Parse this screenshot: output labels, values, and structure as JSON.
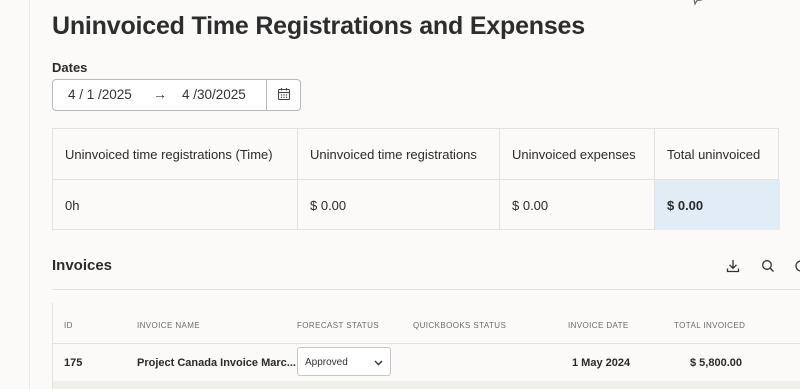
{
  "page": {
    "title": "Uninvoiced Time Registrations and Expenses"
  },
  "dates": {
    "label": "Dates",
    "start": "4 / 1 /2025",
    "arrow": "→",
    "end": "4 /30/2025"
  },
  "summary": {
    "headers": [
      "Uninvoiced time registrations (Time)",
      "Uninvoiced time registrations",
      "Uninvoiced expenses",
      "Total uninvoiced"
    ],
    "values": [
      "0h",
      "$ 0.00",
      "$ 0.00",
      "$ 0.00"
    ],
    "highlight_color": "#e1ecf6"
  },
  "invoices": {
    "title": "Invoices",
    "toolbar_icons": [
      "download-icon",
      "search-icon",
      "more-icon"
    ],
    "columns": [
      "ID",
      "INVOICE NAME",
      "FORECAST STATUS",
      "QUICKBOOKS STATUS",
      "INVOICE DATE",
      "TOTAL INVOICED"
    ],
    "rows": [
      {
        "id": "175",
        "name": "Project Canada Invoice Marc...",
        "forecast_status": "Approved",
        "quickbooks_status": "",
        "invoice_date": "1 May 2024",
        "total": "$ 5,800.00"
      }
    ]
  }
}
